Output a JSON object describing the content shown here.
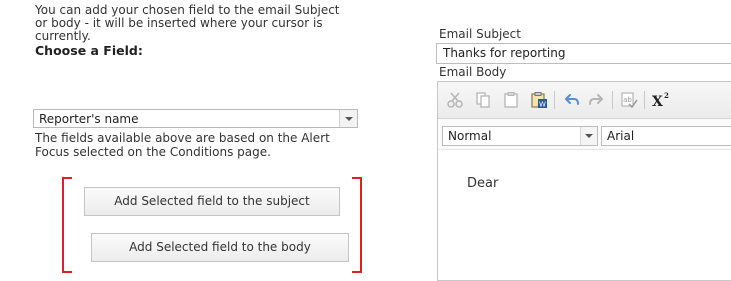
{
  "intro_text": "You can add your chosen field to the email Subject\nor body - it will be inserted where your cursor is\ncurrently.",
  "choose_label": "Choose a Field:",
  "field_select": {
    "value": "Reporter's name"
  },
  "help_text": "The fields available above are based on the Alert\nFocus selected on the Conditions page.",
  "buttons": {
    "add_subject": "Add Selected field to the subject",
    "add_body": "Add Selected field to the body"
  },
  "email_subject": {
    "label": "Email Subject",
    "value": "Thanks for reporting"
  },
  "email_body": {
    "label": "Email Body",
    "toolbar": [
      "cut-icon",
      "copy-icon",
      "paste-icon",
      "paste-from-word-icon",
      "undo-icon",
      "redo-icon",
      "spellcheck-icon",
      "superscript-icon"
    ],
    "superscript_label": "X²",
    "style_value": "Normal",
    "font_value": "Arial",
    "content": "Dear"
  },
  "colors": {
    "highlight_bracket": "#e02020"
  }
}
